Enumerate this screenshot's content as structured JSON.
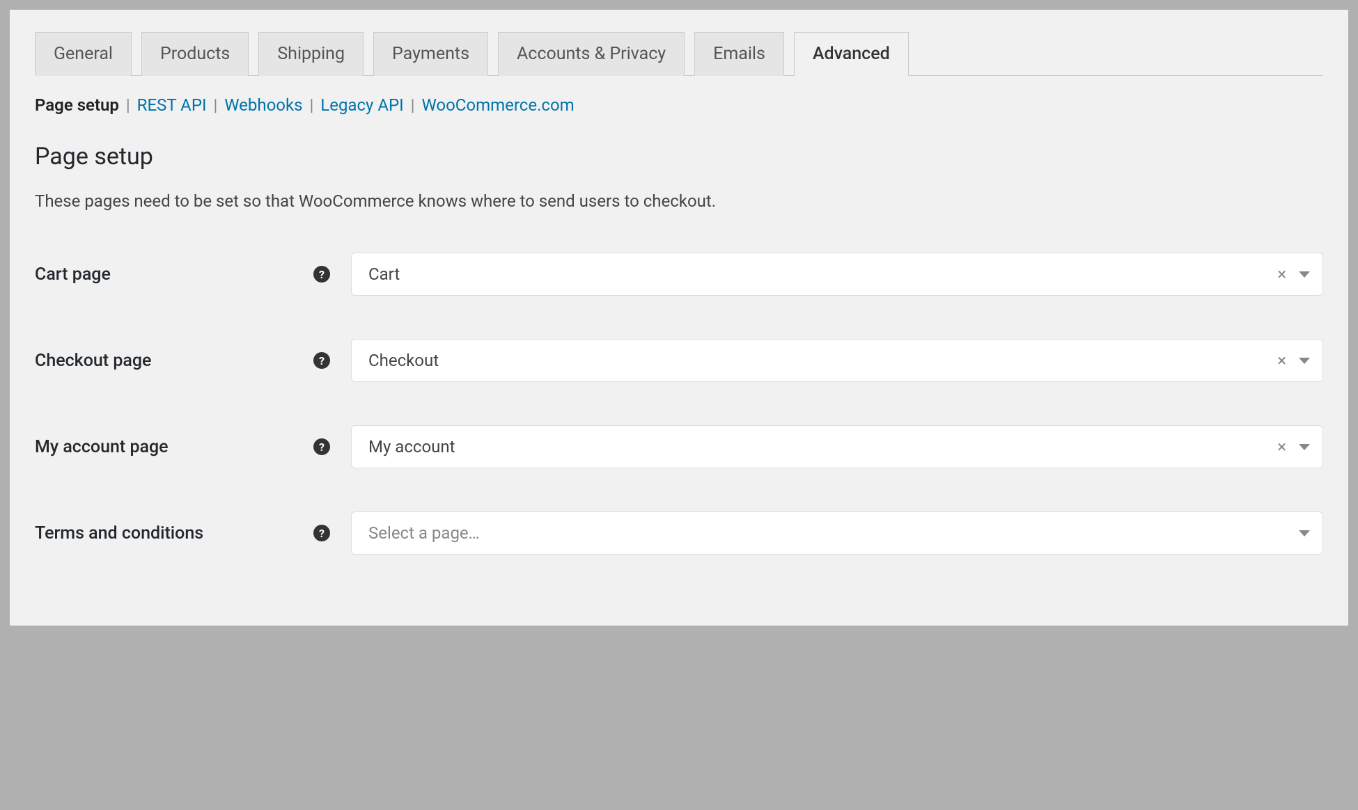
{
  "tabs": {
    "items": [
      {
        "label": "General",
        "active": false
      },
      {
        "label": "Products",
        "active": false
      },
      {
        "label": "Shipping",
        "active": false
      },
      {
        "label": "Payments",
        "active": false
      },
      {
        "label": "Accounts & Privacy",
        "active": false
      },
      {
        "label": "Emails",
        "active": false
      },
      {
        "label": "Advanced",
        "active": true
      }
    ]
  },
  "subnav": {
    "active": "Page setup",
    "links": [
      "REST API",
      "Webhooks",
      "Legacy API",
      "WooCommerce.com"
    ]
  },
  "section": {
    "title": "Page setup",
    "description": "These pages need to be set so that WooCommerce knows where to send users to checkout."
  },
  "fields": {
    "cart": {
      "label": "Cart page",
      "value": "Cart",
      "clearable": true
    },
    "checkout": {
      "label": "Checkout page",
      "value": "Checkout",
      "clearable": true
    },
    "account": {
      "label": "My account page",
      "value": "My account",
      "clearable": true
    },
    "terms": {
      "label": "Terms and conditions",
      "placeholder": "Select a page…",
      "clearable": false
    }
  }
}
